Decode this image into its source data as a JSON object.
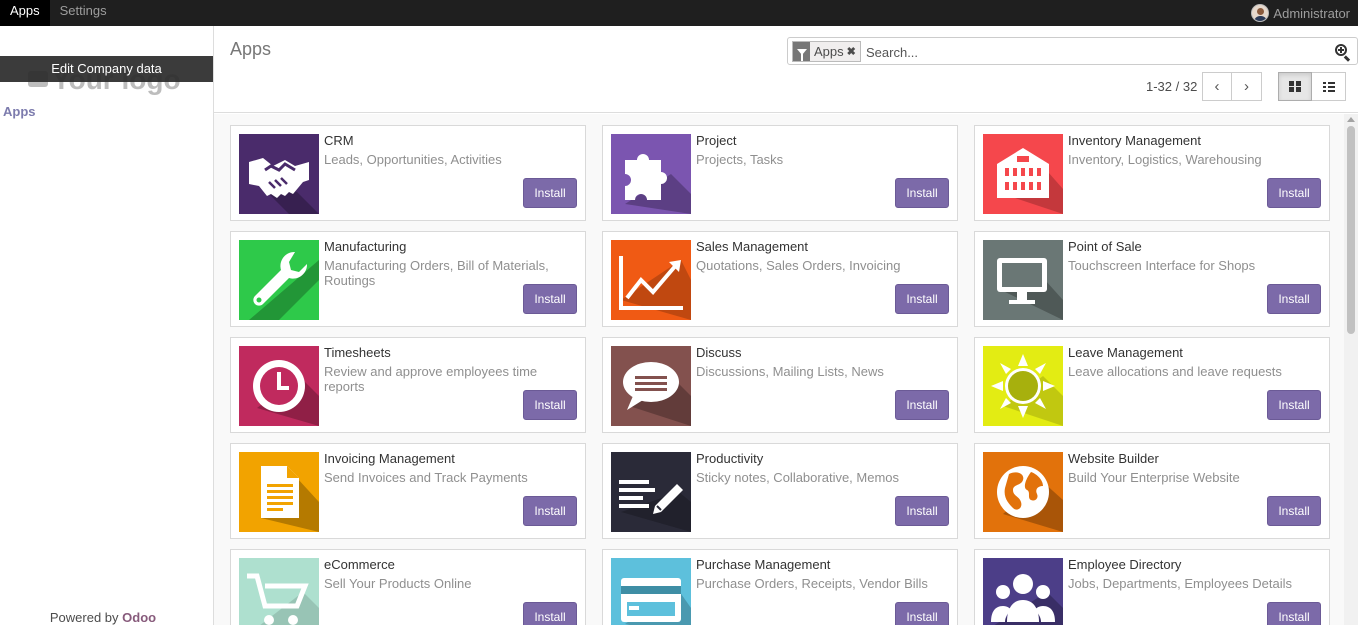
{
  "topbar": {
    "menu": [
      {
        "label": "Apps",
        "active": true
      },
      {
        "label": "Settings",
        "active": false
      }
    ],
    "user": "Administrator"
  },
  "sidebar": {
    "logo_text": "Your logo",
    "edit_company_label": "Edit Company data",
    "links": [
      "Apps"
    ],
    "powered_by_prefix": "Powered by",
    "powered_by_brand": "Odoo"
  },
  "control_panel": {
    "title": "Apps",
    "search": {
      "facet_label": "Apps",
      "facet_remove": "✖",
      "placeholder": "Search..."
    },
    "pager": "1-32 / 32",
    "pager_prev": "‹",
    "pager_next": "›",
    "view_active": "kanban"
  },
  "colors": {
    "install_button": "#7c6aa9",
    "sidebar_link": "#7c7bad",
    "brand": "#875a7b"
  },
  "apps": [
    {
      "name": "CRM",
      "summary": "Leads, Opportunities, Activities",
      "icon": "handshake-icon",
      "color": "#4a2b6b",
      "action": "Install"
    },
    {
      "name": "Project",
      "summary": "Projects, Tasks",
      "icon": "puzzle-icon",
      "color": "#7b55b0",
      "action": "Install"
    },
    {
      "name": "Inventory Management",
      "summary": "Inventory, Logistics, Warehousing",
      "icon": "warehouse-icon",
      "color": "#f5474c",
      "action": "Install"
    },
    {
      "name": "Manufacturing",
      "summary": "Manufacturing Orders, Bill of Materials, Routings",
      "icon": "wrench-icon",
      "color": "#2ec94a",
      "action": "Install"
    },
    {
      "name": "Sales Management",
      "summary": "Quotations, Sales Orders, Invoicing",
      "icon": "trend-chart-icon",
      "color": "#f05a14",
      "action": "Install"
    },
    {
      "name": "Point of Sale",
      "summary": "Touchscreen Interface for Shops",
      "icon": "monitor-icon",
      "color": "#6a7775",
      "action": "Install"
    },
    {
      "name": "Timesheets",
      "summary": "Review and approve employees time reports",
      "icon": "clock-icon",
      "color": "#c02a5e",
      "action": "Install"
    },
    {
      "name": "Discuss",
      "summary": "Discussions, Mailing Lists, News",
      "icon": "chat-bubble-icon",
      "color": "#83514e",
      "action": "Install"
    },
    {
      "name": "Leave Management",
      "summary": "Leave allocations and leave requests",
      "icon": "sun-icon",
      "color": "#e3ec13",
      "action": "Install"
    },
    {
      "name": "Invoicing Management",
      "summary": "Send Invoices and Track Payments",
      "icon": "document-icon",
      "color": "#f2a300",
      "action": "Install"
    },
    {
      "name": "Productivity",
      "summary": "Sticky notes, Collaborative, Memos",
      "icon": "note-pencil-icon",
      "color": "#2a2a38",
      "action": "Install"
    },
    {
      "name": "Website Builder",
      "summary": "Build Your Enterprise Website",
      "icon": "globe-icon",
      "color": "#e2720b",
      "action": "Install"
    },
    {
      "name": "eCommerce",
      "summary": "Sell Your Products Online",
      "icon": "cart-icon",
      "color": "#aee0cf",
      "action": "Install"
    },
    {
      "name": "Purchase Management",
      "summary": "Purchase Orders, Receipts, Vendor Bills",
      "icon": "credit-card-icon",
      "color": "#5dc0dc",
      "action": "Install"
    },
    {
      "name": "Employee Directory",
      "summary": "Jobs, Departments, Employees Details",
      "icon": "people-icon",
      "color": "#4c3e88",
      "action": "Install"
    }
  ]
}
